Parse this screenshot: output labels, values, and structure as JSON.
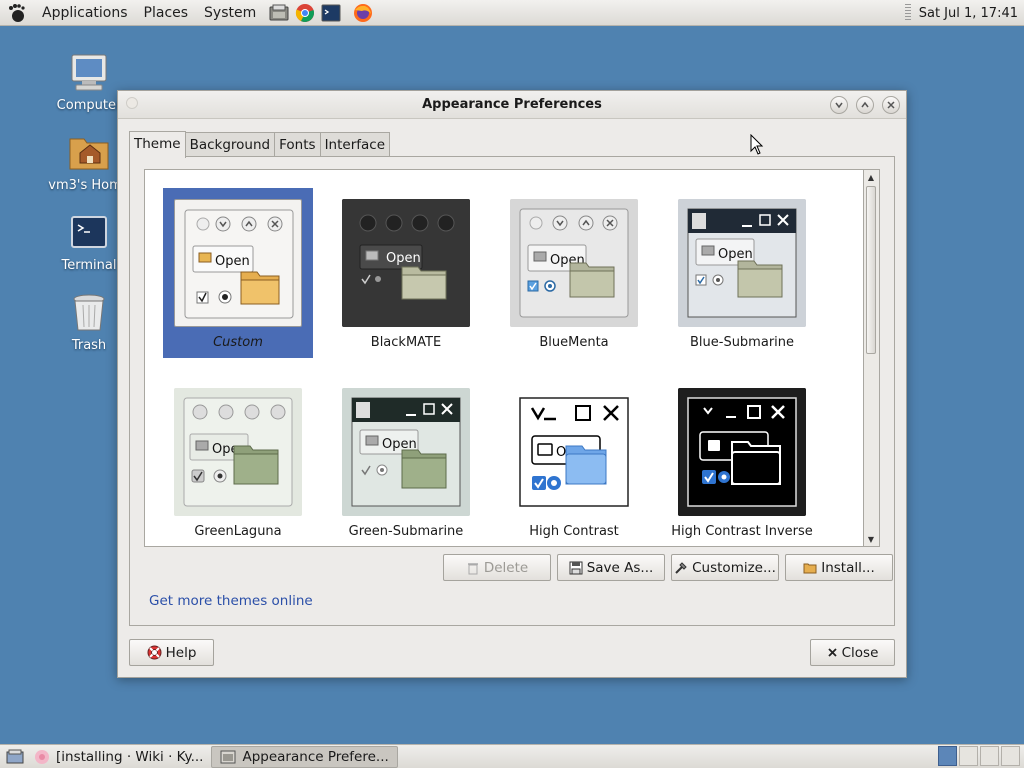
{
  "top_panel": {
    "menus": [
      "Applications",
      "Places",
      "System"
    ],
    "launchers": [
      "file-manager-icon",
      "chrome-icon",
      "terminal-icon",
      "firefox-icon"
    ],
    "clock": "Sat Jul  1, 17:41"
  },
  "desktop": {
    "icons": [
      {
        "label": "Computer",
        "icon": "computer-icon"
      },
      {
        "label": "vm3's Home",
        "icon": "home-folder-icon"
      },
      {
        "label": "Terminal",
        "icon": "terminal-icon"
      },
      {
        "label": "Trash",
        "icon": "trash-icon"
      }
    ]
  },
  "window": {
    "title": "Appearance Preferences",
    "tabs": [
      "Theme",
      "Background",
      "Fonts",
      "Interface"
    ],
    "active_tab": "Theme",
    "themes": [
      {
        "name": "Custom",
        "selected": true
      },
      {
        "name": "BlackMATE",
        "selected": false
      },
      {
        "name": "BlueMenta",
        "selected": false
      },
      {
        "name": "Blue-Submarine",
        "selected": false
      },
      {
        "name": "GreenLaguna",
        "selected": false
      },
      {
        "name": "Green-Submarine",
        "selected": false
      },
      {
        "name": "High Contrast",
        "selected": false
      },
      {
        "name": "High Contrast Inverse",
        "selected": false
      }
    ],
    "thumb_open_label": "Open",
    "thumb_open_partial": "Ope",
    "thumb_open_short": "Op",
    "buttons": {
      "delete": "Delete",
      "save_as": "Save As...",
      "customize": "Customize...",
      "install": "Install..."
    },
    "get_more_link": "Get more themes online",
    "help": "Help",
    "close": "Close"
  },
  "bottom_panel": {
    "tasks": [
      {
        "label": "[installing · Wiki · Ky...",
        "active": false
      },
      {
        "label": "Appearance Prefere...",
        "active": true
      }
    ],
    "workspaces": 4,
    "active_workspace": 1
  },
  "colors": {
    "desktop": "#4f82b0",
    "selection": "#4a6cb5",
    "link": "#2b4fa8"
  }
}
